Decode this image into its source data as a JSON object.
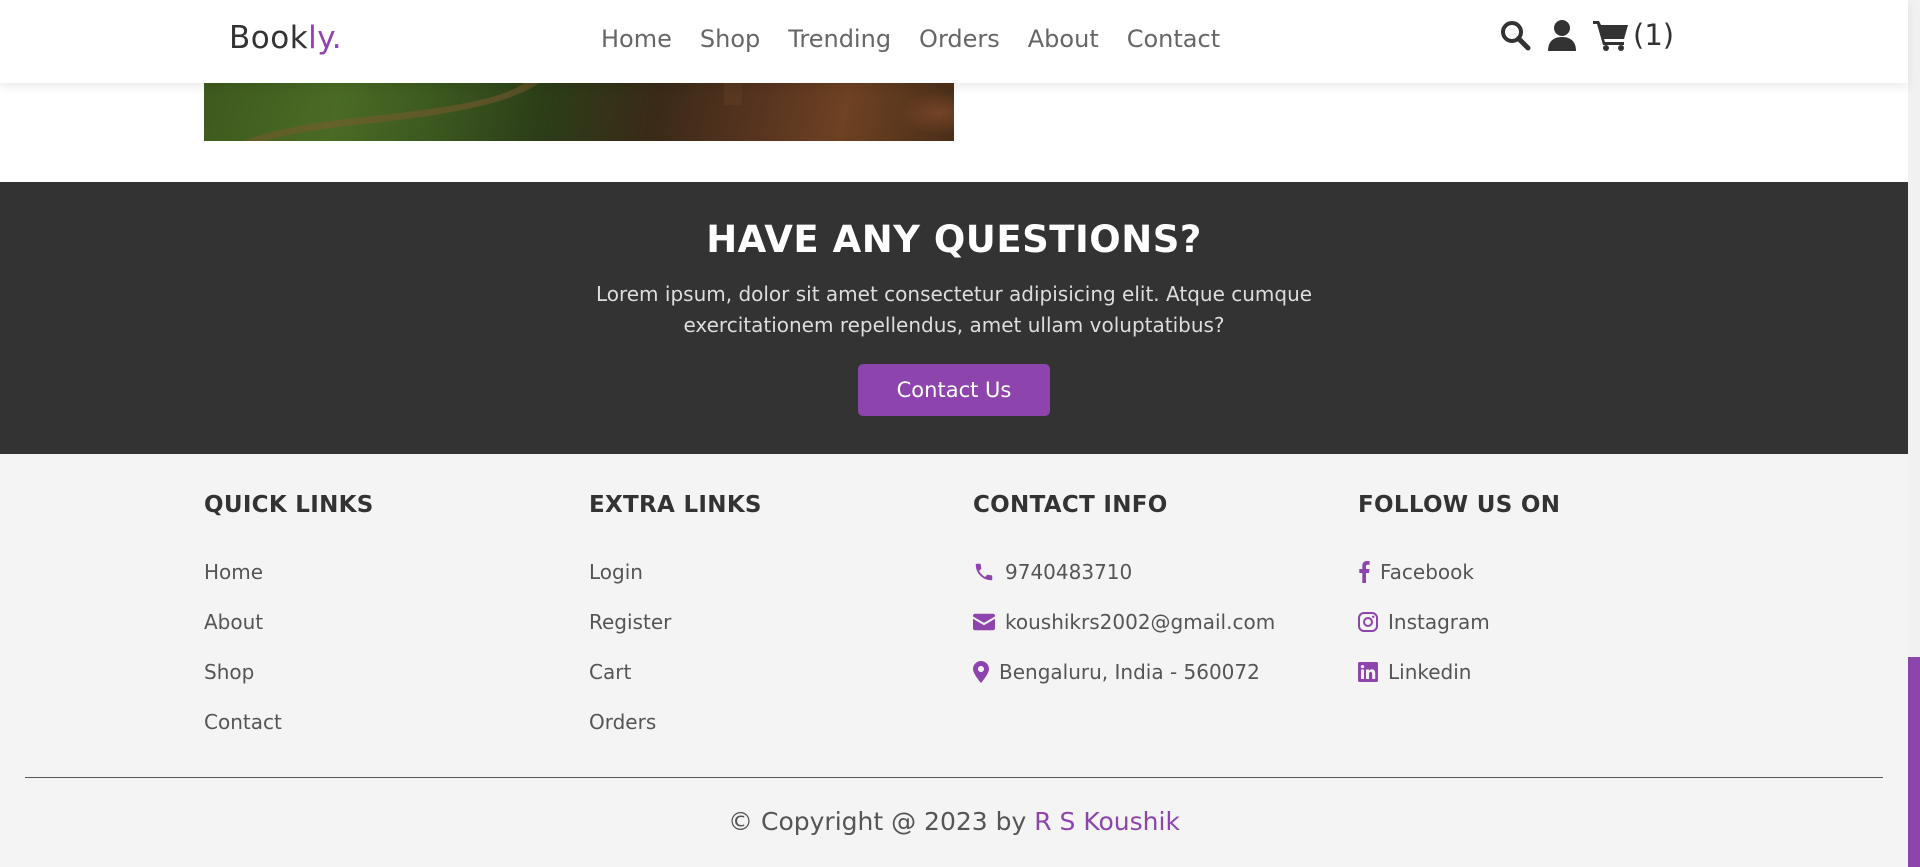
{
  "header": {
    "logo_main": "Book",
    "logo_accent": "ly.",
    "nav": [
      {
        "label": "Home"
      },
      {
        "label": "Shop"
      },
      {
        "label": "Trending"
      },
      {
        "label": "Orders"
      },
      {
        "label": "About"
      },
      {
        "label": "Contact"
      }
    ],
    "cart_count": "(1)",
    "icons": [
      "search-icon",
      "user-icon",
      "cart-icon"
    ]
  },
  "questions": {
    "title": "HAVE ANY QUESTIONS?",
    "text": "Lorem ipsum, dolor sit amet consectetur adipisicing elit. Atque cumque exercitationem repellendus, amet ullam voluptatibus?",
    "button_label": "Contact Us"
  },
  "footer": {
    "quick_links": {
      "title": "QUICK LINKS",
      "items": [
        "Home",
        "About",
        "Shop",
        "Contact"
      ]
    },
    "extra_links": {
      "title": "EXTRA LINKS",
      "items": [
        "Login",
        "Register",
        "Cart",
        "Orders"
      ]
    },
    "contact_info": {
      "title": "CONTACT INFO",
      "phone": "9740483710",
      "email": "koushikrs2002@gmail.com",
      "address": "Bengaluru, India - 560072"
    },
    "follow_us": {
      "title": "FOLLOW US ON",
      "items": [
        "Facebook",
        "Instagram",
        "Linkedin"
      ]
    },
    "copyright_prefix": "© Copyright @ 2023 by",
    "copyright_author": "R S Koushik"
  },
  "colors": {
    "accent": "#8e44ad",
    "dark_section": "#333333",
    "footer_bg": "#f4f4f4"
  }
}
